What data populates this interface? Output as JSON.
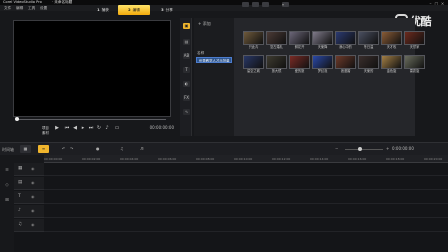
{
  "window": {
    "title": "Corel VideoStudio Pro",
    "title_extra": "· 未命名标题",
    "min": "–",
    "max": "□",
    "close": "×"
  },
  "menu": [
    "文件",
    "编辑",
    "工具",
    "设置"
  ],
  "steps": [
    {
      "num": "1",
      "label": "捕获"
    },
    {
      "num": "2",
      "label": "编辑"
    },
    {
      "num": "3",
      "label": "分享"
    }
  ],
  "player": {
    "project_label": "项目",
    "clip_label": "素材",
    "timecode": "00:00:00:00"
  },
  "library": {
    "add_label": "添加",
    "folder_header": "名称",
    "selected_folder": "优秀教学人才示范单",
    "browse_label": "浏览"
  },
  "thumbnails": [
    {
      "caption": "只此青",
      "color": "#6f5a3b"
    },
    {
      "caption": "复古婚礼",
      "color": "#4c3b36"
    },
    {
      "caption": "鲜花开",
      "color": "#6b6678"
    },
    {
      "caption": "天使降",
      "color": "#7f7a8a"
    },
    {
      "caption": "我心中的",
      "color": "#2b3a72"
    },
    {
      "caption": "冬日温",
      "color": "#4a4f60"
    },
    {
      "caption": "天才玫",
      "color": "#8a5c36"
    },
    {
      "caption": "天然家",
      "color": "#6c2a1d"
    },
    {
      "caption": "星空之城",
      "color": "#283766"
    },
    {
      "caption": "放大镜",
      "color": "#3e3b30"
    },
    {
      "caption": "爱的旅",
      "color": "#7b2b25"
    },
    {
      "caption": "梦幻泡",
      "color": "#2a49a8"
    },
    {
      "caption": "浪漫婚",
      "color": "#6d3a2a"
    },
    {
      "caption": "天使的",
      "color": "#3a2e2c"
    },
    {
      "caption": "金色旋",
      "color": "#a37f45"
    },
    {
      "caption": "雷霆旋",
      "color": "#6a6d5e"
    }
  ],
  "watermark": {
    "text": "优酷"
  },
  "timeline": {
    "label": "时间轴",
    "timecode": "0:00:00:00",
    "ticks": [
      "00:00:00:00",
      "00:00:02:00",
      "00:00:04:00",
      "00:00:06:00",
      "00:00:08:00",
      "00:00:10:00",
      "00:00:12:00",
      "00:00:14:00",
      "00:00:16:00",
      "00:00:18:00",
      "00:00:20:00"
    ]
  }
}
